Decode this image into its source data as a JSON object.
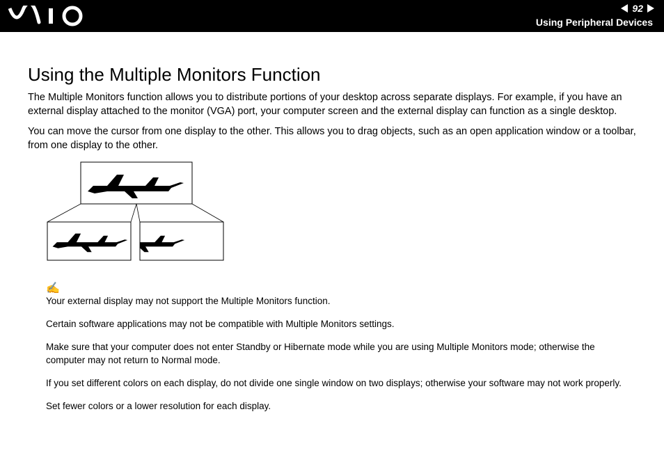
{
  "header": {
    "page_number": "92",
    "section": "Using Peripheral Devices"
  },
  "title": "Using the Multiple Monitors Function",
  "paragraphs": {
    "p1": "The Multiple Monitors function allows you to distribute portions of your desktop across separate displays. For example, if you have an external display attached to the monitor (VGA) port, your computer screen and the external display can function as a single desktop.",
    "p2": "You can move the cursor from one display to the other. This allows you to drag objects, such as an open application window or a toolbar, from one display to the other."
  },
  "notes": {
    "n1": "Your external display may not support the Multiple Monitors function.",
    "n2": "Certain software applications may not be compatible with Multiple Monitors settings.",
    "n3": "Make sure that your computer does not enter Standby or Hibernate mode while you are using Multiple Monitors mode; otherwise the computer may not return to Normal mode.",
    "n4": "If you set different colors on each display, do not divide one single window on two displays; otherwise your software may not work properly.",
    "n5": "Set fewer colors or a lower resolution for each display."
  }
}
